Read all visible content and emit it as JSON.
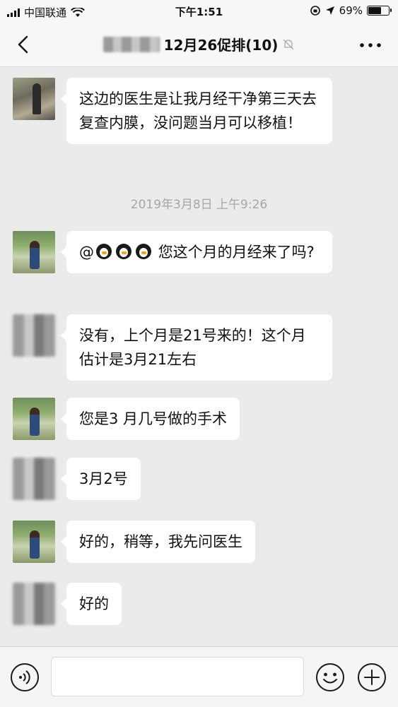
{
  "status_bar": {
    "carrier": "中国联通",
    "time": "下午1:51",
    "battery": "69%",
    "battery_level": 0.69
  },
  "nav": {
    "title": "12月26促排(10)"
  },
  "timestamp": "2019年3月8日 上午9:26",
  "messages": [
    {
      "text": "这边的医生是让我月经干净第三天去复查内膜，没问题当月可以移植！"
    },
    {
      "prefix": "@",
      "text": "您这个月的月经来了吗?"
    },
    {
      "text": "没有，上个月是21号来的！这个月估计是3月21左右"
    },
    {
      "text": "您是3 月几号做的手术"
    },
    {
      "text": "3月2号"
    },
    {
      "text": "好的，稍等，我先问医生"
    },
    {
      "text": "好的"
    }
  ],
  "icons": {
    "back": "chevron-left-icon",
    "mute": "bell-muted-icon",
    "more": "more-dots-icon",
    "voice": "voice-icon",
    "emoji": "emoji-icon",
    "plus": "plus-icon"
  }
}
